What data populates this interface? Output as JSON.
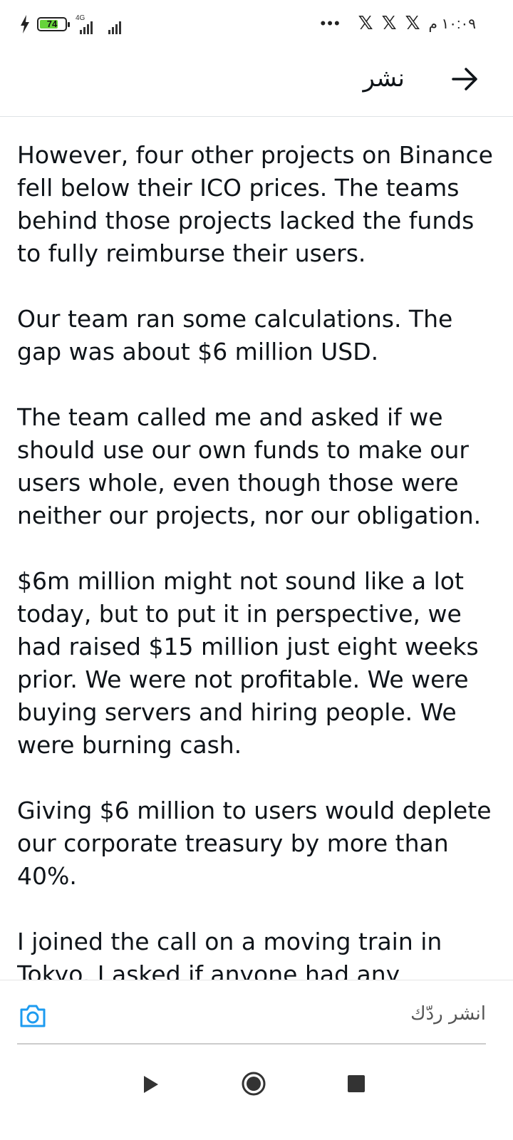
{
  "status_bar": {
    "battery_level": 74,
    "battery_label": "74",
    "network_label": "4G",
    "notification_icons": [
      "x-logo-icon",
      "x-logo-icon",
      "x-logo-icon"
    ],
    "more_indicator": "•••",
    "time": "١٠:٠٩ م"
  },
  "header": {
    "title": "نشر",
    "back_icon": "arrow-right-icon"
  },
  "article": {
    "paragraphs": [
      "However, four other projects on Binance fell below their ICO prices. The teams behind those projects lacked the funds to fully reimburse their users.",
      "Our team ran some calculations. The gap was about $6 million USD.",
      "The team called me and asked if we should use our own funds to make our users whole, even though those were neither our projects, nor our obligation.",
      "$6m million might not sound like a lot today, but to put it in perspective, we had raised $15 million just eight weeks prior. We were not profitable. We were buying servers and hiring people. We were burning cash.",
      "Giving $6 million to users would deplete our corporate treasury by more than 40%.",
      "I joined the call on a moving train in Tokyo. I asked if anyone had any"
    ]
  },
  "reply_bar": {
    "placeholder": "انشر ردّك",
    "camera_icon": "camera-icon"
  },
  "nav_bar": {
    "icons": [
      "back-triangle-icon",
      "home-circle-icon",
      "recents-square-icon"
    ]
  },
  "colors": {
    "accent": "#1d9bf0",
    "battery_fill": "#66d33b",
    "text": "#0f1419"
  }
}
